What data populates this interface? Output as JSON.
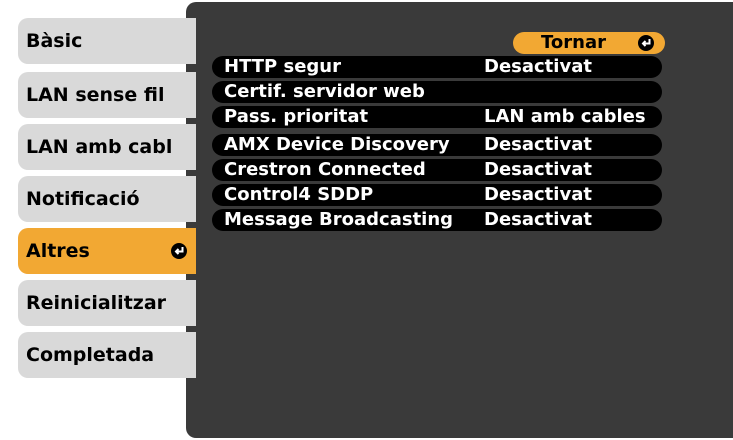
{
  "sidebar": {
    "items": [
      {
        "label": "Bàsic"
      },
      {
        "label": "LAN sense fil"
      },
      {
        "label": "LAN amb cabl"
      },
      {
        "label": "Notificació"
      },
      {
        "label": "Altres"
      },
      {
        "label": "Reinicialitzar"
      },
      {
        "label": "Completada"
      }
    ],
    "active_index": 4
  },
  "header": {
    "back_label": "Tornar"
  },
  "settings": [
    {
      "label": "HTTP segur",
      "value": "Desactivat"
    },
    {
      "label": "Certif. servidor web",
      "value": ""
    },
    {
      "label": "Pass. prioritat",
      "value": "LAN amb cables"
    },
    {
      "label": "AMX Device Discovery",
      "value": "Desactivat"
    },
    {
      "label": "Crestron Connected",
      "value": "Desactivat"
    },
    {
      "label": "Control4 SDDP",
      "value": "Desactivat"
    },
    {
      "label": "Message Broadcasting",
      "value": "Desactivat"
    }
  ],
  "colors": {
    "accent": "#f2a833",
    "tab_bg": "#d9d9d9",
    "panel_bg": "#3a3a3a",
    "row_bg": "#000000"
  }
}
